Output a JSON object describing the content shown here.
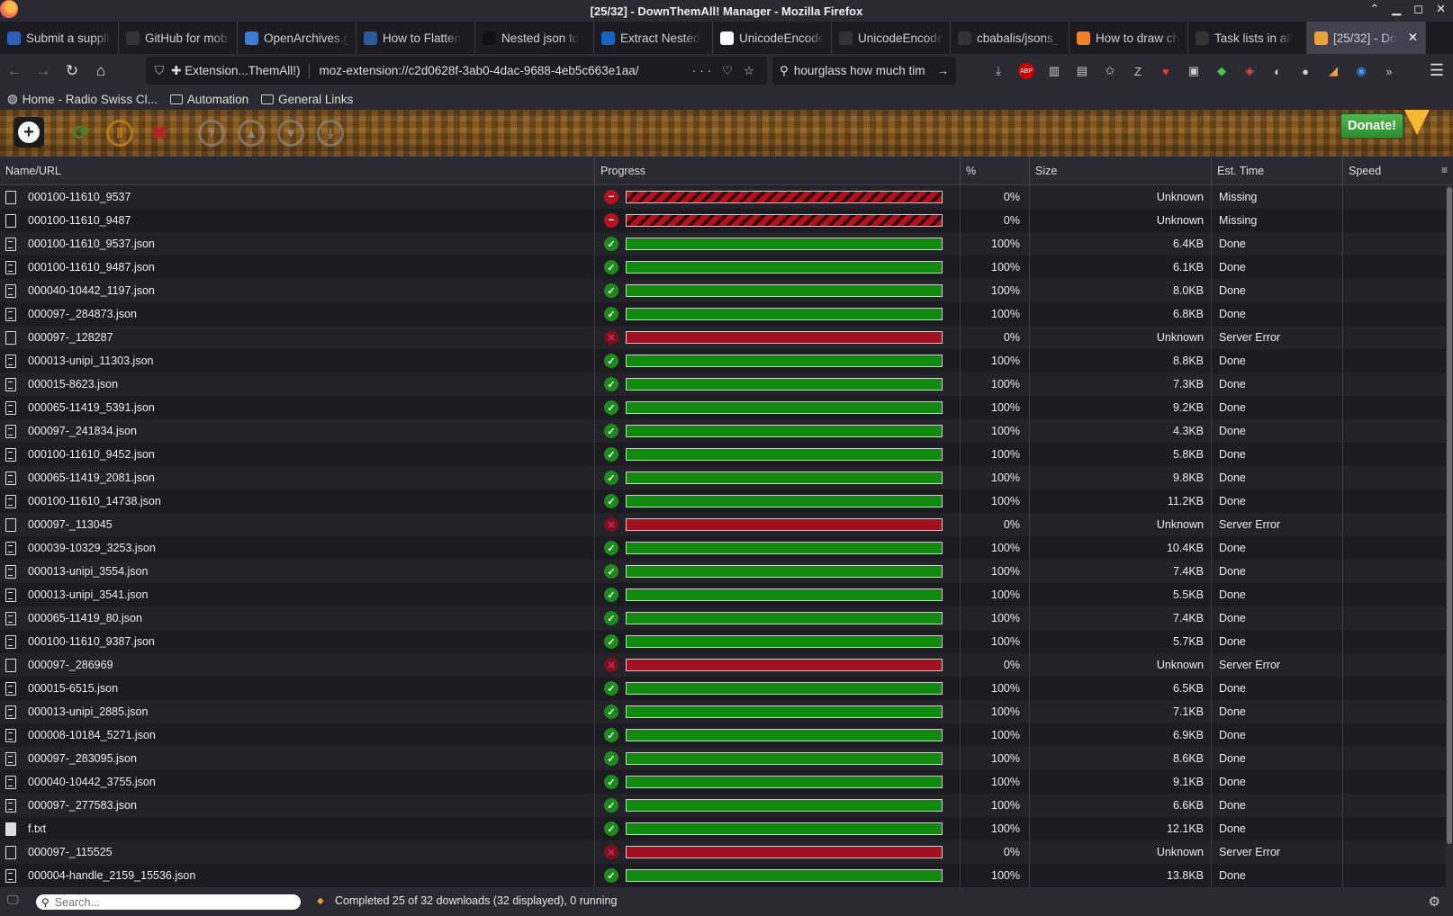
{
  "window": {
    "title": "[25/32] - DownThemAll! Manager - Mozilla Firefox"
  },
  "tabs": [
    {
      "label": "Submit a supplier",
      "icon": "FM",
      "color": "#2d5fb8"
    },
    {
      "label": "GitHub for mobile",
      "icon": "github-icon",
      "color": "#333"
    },
    {
      "label": "OpenArchives.gr",
      "icon": "oa",
      "color": "#3a7bd5"
    },
    {
      "label": "How to Flatten",
      "icon": "tds",
      "color": "#2b5a9a"
    },
    {
      "label": "Nested json to",
      "icon": "DEV",
      "color": "#111"
    },
    {
      "label": "Extract Nested",
      "icon": "h",
      "color": "#1565c0"
    },
    {
      "label": "UnicodeEncode",
      "icon": "G",
      "color": "#fff"
    },
    {
      "label": "UnicodeEncode",
      "icon": "github-icon",
      "color": "#333"
    },
    {
      "label": "cbabalis/jsons_",
      "icon": "github-icon",
      "color": "#333"
    },
    {
      "label": "How to draw ch",
      "icon": "so",
      "color": "#f48024"
    },
    {
      "label": "Task lists in all",
      "icon": "github-icon",
      "color": "#333"
    },
    {
      "label": "[25/32] - Do",
      "icon": "dta",
      "color": "#e8a33a",
      "active": true
    }
  ],
  "nav": {
    "extension_label": "Extension...ThemAll!)",
    "url": "moz-extension://c2d0628f-3ab0-4dac-9688-4eb5c663e1aa/",
    "search_value": "hourglass how much tim"
  },
  "bookmarks": [
    {
      "label": "Home - Radio Swiss Cl...",
      "type": "page"
    },
    {
      "label": "Automation",
      "type": "folder"
    },
    {
      "label": "General Links",
      "type": "folder"
    }
  ],
  "toolbar": {
    "donate_label": "Donate!"
  },
  "columns": {
    "name": "Name/URL",
    "progress": "Progress",
    "percent": "%",
    "size": "Size",
    "est_time": "Est. Time",
    "speed": "Speed"
  },
  "downloads": [
    {
      "name": "000100-11610_9537",
      "file": "blank",
      "status": "missing",
      "percent": "0%",
      "size": "Unknown",
      "est": "Missing"
    },
    {
      "name": "000100-11610_9487",
      "file": "blank",
      "status": "missing",
      "percent": "0%",
      "size": "Unknown",
      "est": "Missing"
    },
    {
      "name": "000100-11610_9537.json",
      "file": "json",
      "status": "done",
      "percent": "100%",
      "size": "6.4KB",
      "est": "Done"
    },
    {
      "name": "000100-11610_9487.json",
      "file": "json",
      "status": "done",
      "percent": "100%",
      "size": "6.1KB",
      "est": "Done"
    },
    {
      "name": "000040-10442_1197.json",
      "file": "json",
      "status": "done",
      "percent": "100%",
      "size": "8.0KB",
      "est": "Done"
    },
    {
      "name": "000097-_284873.json",
      "file": "json",
      "status": "done",
      "percent": "100%",
      "size": "6.8KB",
      "est": "Done"
    },
    {
      "name": "000097-_128287",
      "file": "blank",
      "status": "error",
      "percent": "0%",
      "size": "Unknown",
      "est": "Server Error"
    },
    {
      "name": "000013-unipi_11303.json",
      "file": "json",
      "status": "done",
      "percent": "100%",
      "size": "8.8KB",
      "est": "Done"
    },
    {
      "name": "000015-8623.json",
      "file": "json",
      "status": "done",
      "percent": "100%",
      "size": "7.3KB",
      "est": "Done"
    },
    {
      "name": "000065-11419_5391.json",
      "file": "json",
      "status": "done",
      "percent": "100%",
      "size": "9.2KB",
      "est": "Done"
    },
    {
      "name": "000097-_241834.json",
      "file": "json",
      "status": "done",
      "percent": "100%",
      "size": "4.3KB",
      "est": "Done"
    },
    {
      "name": "000100-11610_9452.json",
      "file": "json",
      "status": "done",
      "percent": "100%",
      "size": "5.8KB",
      "est": "Done"
    },
    {
      "name": "000065-11419_2081.json",
      "file": "json",
      "status": "done",
      "percent": "100%",
      "size": "9.8KB",
      "est": "Done"
    },
    {
      "name": "000100-11610_14738.json",
      "file": "json",
      "status": "done",
      "percent": "100%",
      "size": "11.2KB",
      "est": "Done"
    },
    {
      "name": "000097-_113045",
      "file": "blank",
      "status": "error",
      "percent": "0%",
      "size": "Unknown",
      "est": "Server Error"
    },
    {
      "name": "000039-10329_3253.json",
      "file": "json",
      "status": "done",
      "percent": "100%",
      "size": "10.4KB",
      "est": "Done"
    },
    {
      "name": "000013-unipi_3554.json",
      "file": "json",
      "status": "done",
      "percent": "100%",
      "size": "7.4KB",
      "est": "Done"
    },
    {
      "name": "000013-unipi_3541.json",
      "file": "json",
      "status": "done",
      "percent": "100%",
      "size": "5.5KB",
      "est": "Done"
    },
    {
      "name": "000065-11419_80.json",
      "file": "json",
      "status": "done",
      "percent": "100%",
      "size": "7.4KB",
      "est": "Done"
    },
    {
      "name": "000100-11610_9387.json",
      "file": "json",
      "status": "done",
      "percent": "100%",
      "size": "5.7KB",
      "est": "Done"
    },
    {
      "name": "000097-_286969",
      "file": "blank",
      "status": "error",
      "percent": "0%",
      "size": "Unknown",
      "est": "Server Error"
    },
    {
      "name": "000015-6515.json",
      "file": "json",
      "status": "done",
      "percent": "100%",
      "size": "6.5KB",
      "est": "Done"
    },
    {
      "name": "000013-unipi_2885.json",
      "file": "json",
      "status": "done",
      "percent": "100%",
      "size": "7.1KB",
      "est": "Done"
    },
    {
      "name": "000008-10184_5271.json",
      "file": "json",
      "status": "done",
      "percent": "100%",
      "size": "6.9KB",
      "est": "Done"
    },
    {
      "name": "000097-_283095.json",
      "file": "json",
      "status": "done",
      "percent": "100%",
      "size": "8.6KB",
      "est": "Done"
    },
    {
      "name": "000040-10442_3755.json",
      "file": "json",
      "status": "done",
      "percent": "100%",
      "size": "9.1KB",
      "est": "Done"
    },
    {
      "name": "000097-_277583.json",
      "file": "json",
      "status": "done",
      "percent": "100%",
      "size": "6.6KB",
      "est": "Done"
    },
    {
      "name": "f.txt",
      "file": "txt",
      "status": "done",
      "percent": "100%",
      "size": "12.1KB",
      "est": "Done"
    },
    {
      "name": "000097-_115525",
      "file": "blank",
      "status": "error",
      "percent": "0%",
      "size": "Unknown",
      "est": "Server Error"
    },
    {
      "name": "000004-handle_2159_15536.json",
      "file": "json",
      "status": "done",
      "percent": "100%",
      "size": "13.8KB",
      "est": "Done"
    }
  ],
  "status": {
    "search_placeholder": "Search...",
    "summary": "Completed 25 of 32 downloads (32 displayed), 0 running"
  },
  "colors": {
    "done": "#0f8a0f",
    "error": "#a0101e",
    "missing": "#b1121c",
    "donate": "#3aa23a"
  }
}
